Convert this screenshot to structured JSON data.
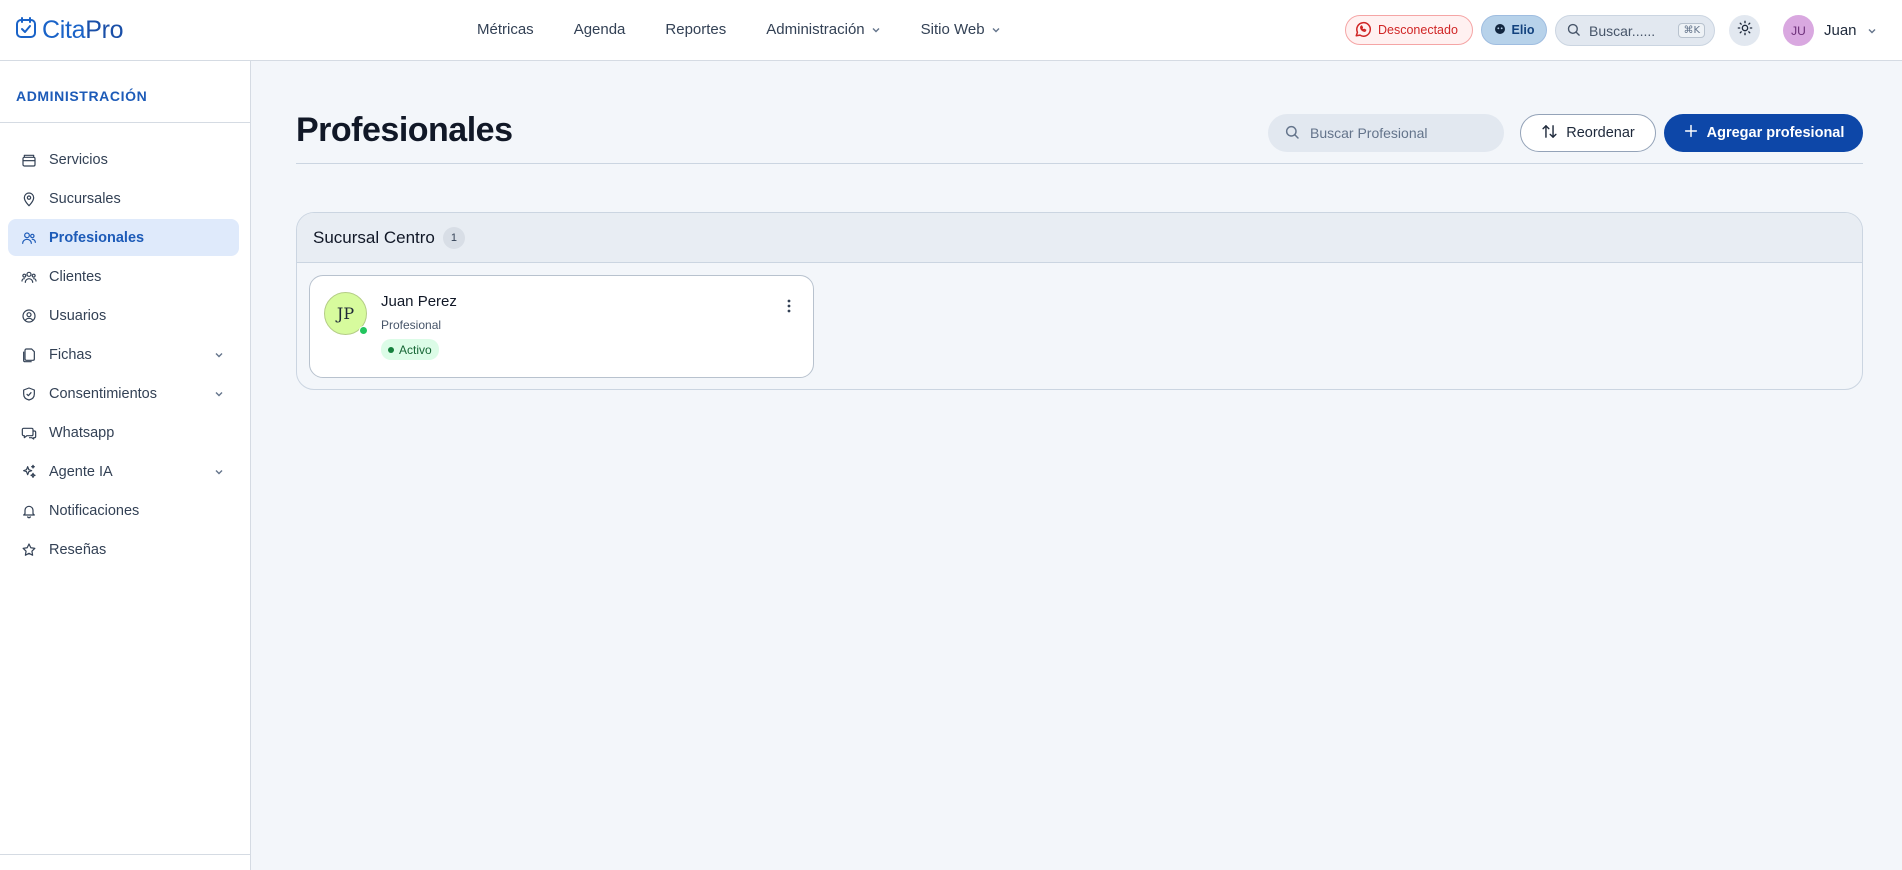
{
  "app": {
    "name_part1": "Cita",
    "name_part2": "Pro"
  },
  "topnav": [
    {
      "label": "Métricas",
      "has_dropdown": false
    },
    {
      "label": "Agenda",
      "has_dropdown": false
    },
    {
      "label": "Reportes",
      "has_dropdown": false
    },
    {
      "label": "Administración",
      "has_dropdown": true
    },
    {
      "label": "Sitio Web",
      "has_dropdown": true
    }
  ],
  "header": {
    "whatsapp_status": "Desconectado",
    "assistant_label": "Elio",
    "search_placeholder": "Buscar......",
    "search_shortcut": "⌘K",
    "user_initials": "JU",
    "user_name": "Juan"
  },
  "sidebar": {
    "title": "ADMINISTRACIÓN",
    "items": [
      {
        "label": "Servicios",
        "icon": "box-icon",
        "active": false,
        "expandable": false
      },
      {
        "label": "Sucursales",
        "icon": "map-pin-icon",
        "active": false,
        "expandable": false
      },
      {
        "label": "Profesionales",
        "icon": "users-icon",
        "active": true,
        "expandable": false
      },
      {
        "label": "Clientes",
        "icon": "clients-icon",
        "active": false,
        "expandable": false
      },
      {
        "label": "Usuarios",
        "icon": "user-circle-icon",
        "active": false,
        "expandable": false
      },
      {
        "label": "Fichas",
        "icon": "files-icon",
        "active": false,
        "expandable": true
      },
      {
        "label": "Consentimientos",
        "icon": "shield-check-icon",
        "active": false,
        "expandable": true
      },
      {
        "label": "Whatsapp",
        "icon": "chat-icon",
        "active": false,
        "expandable": false
      },
      {
        "label": "Agente IA",
        "icon": "sparkles-icon",
        "active": false,
        "expandable": true
      },
      {
        "label": "Notificaciones",
        "icon": "bell-icon",
        "active": false,
        "expandable": false
      },
      {
        "label": "Reseñas",
        "icon": "star-icon",
        "active": false,
        "expandable": false
      }
    ]
  },
  "main": {
    "title": "Profesionales",
    "search_placeholder": "Buscar Profesional",
    "reorder_label": "Reordenar",
    "add_label": "Agregar profesional"
  },
  "groups": [
    {
      "name": "Sucursal Centro",
      "count": "1",
      "professionals": [
        {
          "initials": "JP",
          "name": "Juan Perez",
          "role": "Profesional",
          "status": "Activo"
        }
      ]
    }
  ],
  "colors": {
    "brand": "#1a63c8",
    "primary_button": "#0d47a8",
    "active_bg": "#dfeafb",
    "status_green": "#22c55e",
    "disconnected_red": "#d02626"
  }
}
